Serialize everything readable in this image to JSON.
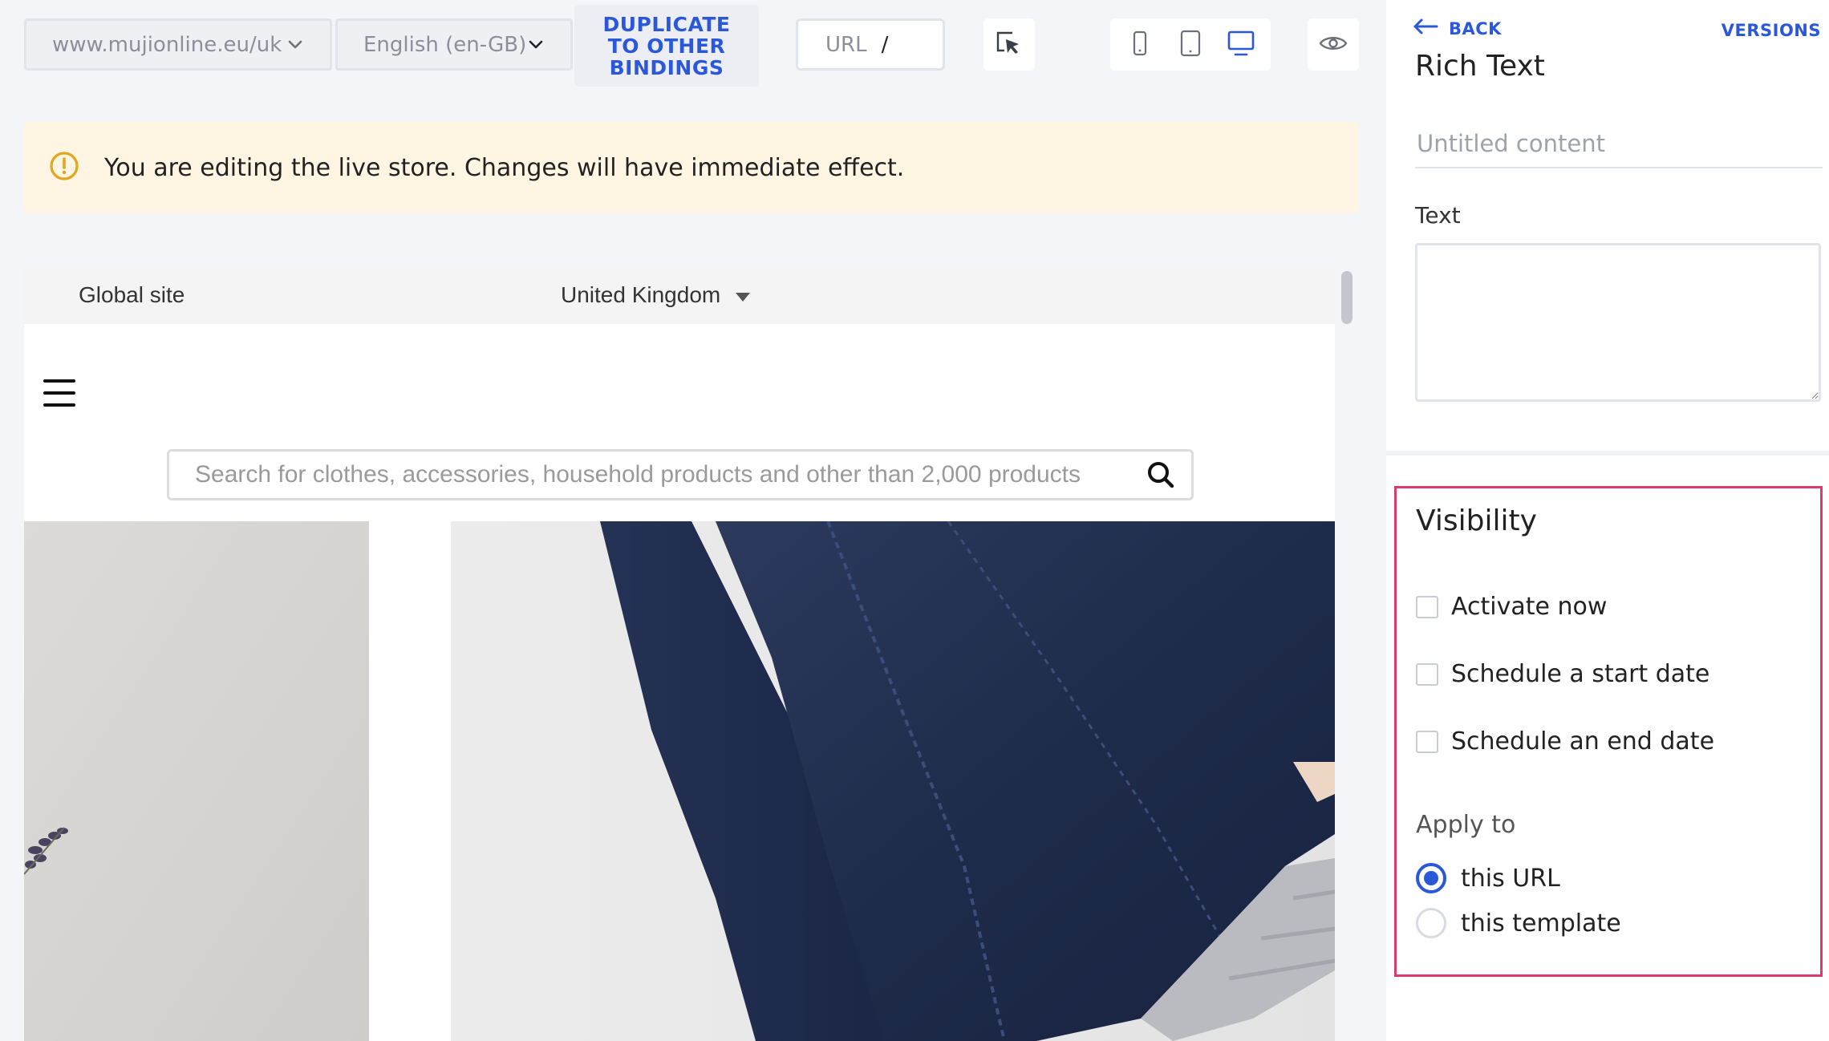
{
  "toolbar": {
    "domain_select": "www.mujionline.eu/uk",
    "language_select": "English (en-GB)",
    "duplicate_button": "DUPLICATE TO OTHER BINDINGS",
    "url_label": "URL",
    "url_value": "/"
  },
  "banner": {
    "message": "You are editing the live store. Changes will have immediate effect.",
    "icon": "warning-icon"
  },
  "preview": {
    "global_site": "Global site",
    "country": "United Kingdom",
    "search_placeholder": "Search for clothes, accessories, household products and other than 2,000 products"
  },
  "panel": {
    "back": "BACK",
    "versions": "VERSIONS",
    "title": "Rich Text",
    "name_placeholder": "Untitled content",
    "text_label": "Text",
    "text_value": "",
    "visibility_title": "Visibility",
    "checkboxes": [
      {
        "label": "Activate now",
        "checked": false
      },
      {
        "label": "Schedule a start date",
        "checked": false
      },
      {
        "label": "Schedule an end date",
        "checked": false
      }
    ],
    "apply_to_label": "Apply to",
    "apply_to_options": [
      {
        "label": "this URL",
        "selected": true
      },
      {
        "label": "this template",
        "selected": false
      }
    ]
  },
  "colors": {
    "accent": "#2b58d9",
    "highlight_border": "#db3b6d",
    "banner_bg": "#fef6e3",
    "warning": "#e3a520"
  }
}
